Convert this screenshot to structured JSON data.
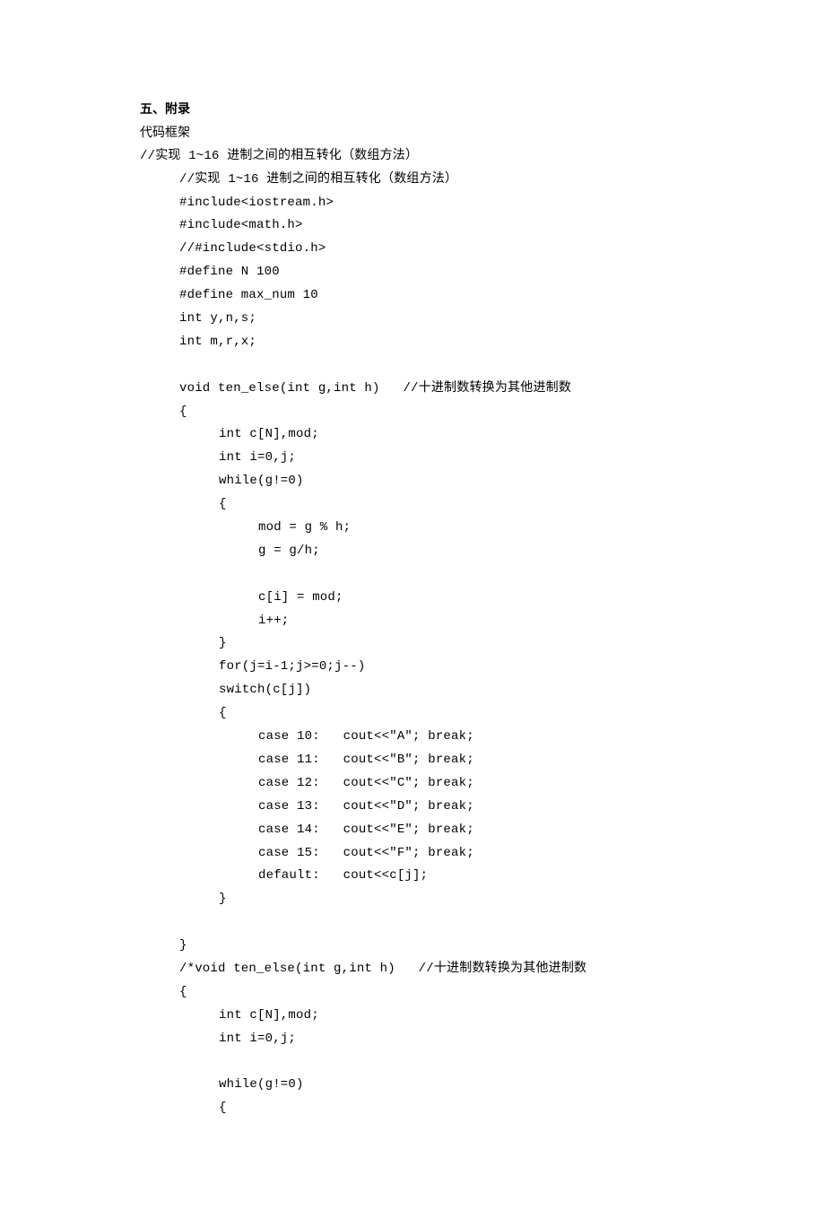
{
  "section_heading": "五、附录",
  "subheading": "代码框架",
  "top_comment": "//实现 1~16 进制之间的相互转化（数组方法）",
  "lines": {
    "a1": "//实现 1~16 进制之间的相互转化（数组方法）",
    "a2": "#include<iostream.h>",
    "a3": "#include<math.h>",
    "a4": "//#include<stdio.h>",
    "a5": "#define N 100",
    "a6": "#define max_num 10",
    "a7": "int y,n,s;",
    "a8": "int m,r,x;",
    "b1": "void ten_else(int g,int h)   //十进制数转换为其他进制数",
    "b2": "{",
    "c1": "int c[N],mod;",
    "c2": "int i=0,j;",
    "c3": "while(g!=0)",
    "c4": "{",
    "d1": "mod = g % h;",
    "d2": "g = g/h;",
    "d3": "c[i] = mod;",
    "d4": "i++;",
    "c5": "}",
    "c6": "for(j=i-1;j>=0;j--)",
    "c7": "switch(c[j])",
    "c8": "{",
    "e1": "case 10:   cout<<\"A\"; break;",
    "e2": "case 11:   cout<<\"B\"; break;",
    "e3": "case 12:   cout<<\"C\"; break;",
    "e4": "case 13:   cout<<\"D\"; break;",
    "e5": "case 14:   cout<<\"E\"; break;",
    "e6": "case 15:   cout<<\"F\"; break;",
    "e7": "default:   cout<<c[j];",
    "c9": "}",
    "b3": "}",
    "f1": "/*void ten_else(int g,int h)   //十进制数转换为其他进制数",
    "f2": "{",
    "g1": "int c[N],mod;",
    "g2": "int i=0,j;",
    "g3": "while(g!=0)",
    "g4": "{"
  }
}
